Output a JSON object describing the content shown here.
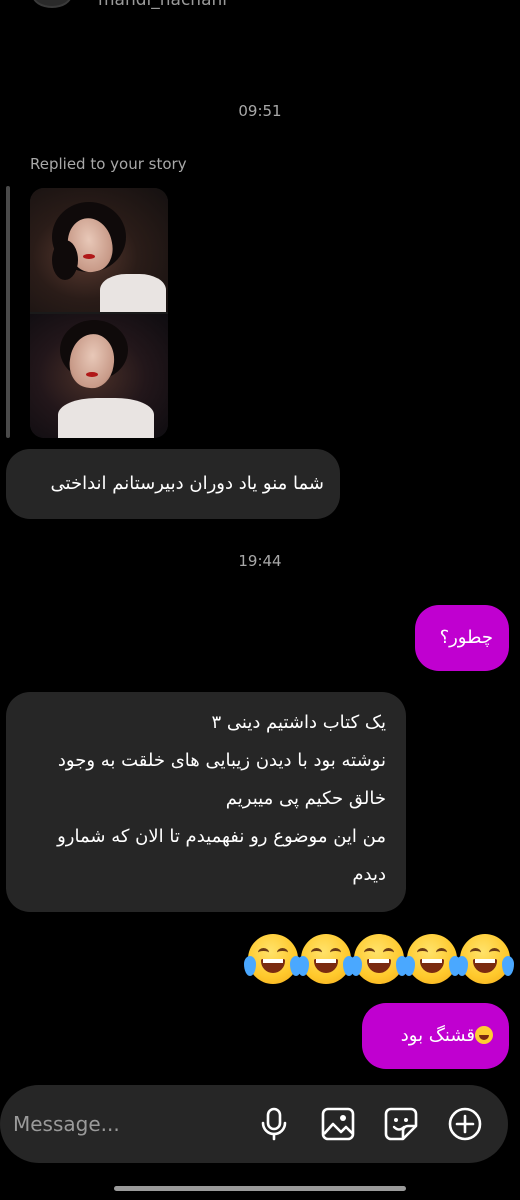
{
  "header": {
    "username": "mahdi_hachani"
  },
  "thread": {
    "time_1": "09:51",
    "replied_label": "Replied to your story",
    "msg_1": "شما منو یاد دوران دبیرستانم انداختی",
    "time_2": "19:44",
    "msg_out_1": "چطور؟",
    "msg_2_lines": [
      "یک کتاب داشتیم دینی ۳",
      "نوشته بود با دیدن زیبایی های خلقت به وجود",
      "خالق حکیم پی میبریم",
      "من این موضوع رو نفهمیدم تا الان که شمارو",
      "دیدم"
    ],
    "emoji_reaction": "😂😂😂😂😂",
    "msg_out_2": "قشنگ بود"
  },
  "composer": {
    "placeholder": "Message...",
    "value": "",
    "icons": [
      "microphone-icon",
      "gallery-icon",
      "sticker-icon",
      "plus-circle-icon"
    ]
  },
  "colors": {
    "background": "#000000",
    "incoming_bubble": "#262626",
    "outgoing_bubble": "#c000d0",
    "meta_text": "#a8a8a8"
  }
}
